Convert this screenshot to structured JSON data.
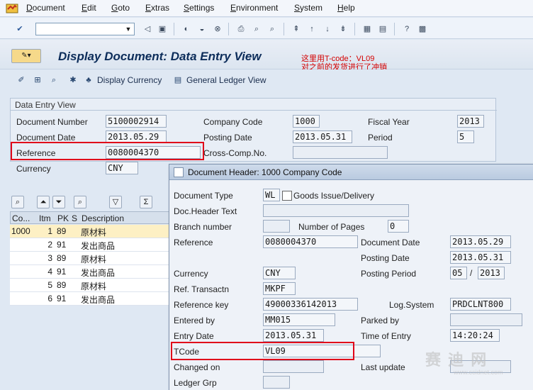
{
  "menu": [
    "Document",
    "Edit",
    "Goto",
    "Extras",
    "Settings",
    "Environment",
    "System",
    "Help"
  ],
  "page_title": "Display Document: Data Entry View",
  "annotation": {
    "line1": "这里用T-code：VL09",
    "line2": "对之前的发货进行了冲销"
  },
  "app_toolbar": {
    "display_currency": "Display Currency",
    "gl_view": "General Ledger View"
  },
  "data_entry": {
    "group_title": "Data Entry View",
    "document_number_label": "Document Number",
    "document_number": "5100002914",
    "document_date_label": "Document Date",
    "document_date": "2013.05.29",
    "reference_label": "Reference",
    "reference": "0080004370",
    "currency_label": "Currency",
    "currency": "CNY",
    "company_code_label": "Company Code",
    "company_code": "1000",
    "posting_date_label": "Posting Date",
    "posting_date": "2013.05.31",
    "cross_comp_label": "Cross-Comp.No.",
    "cross_comp": "",
    "fiscal_year_label": "Fiscal Year",
    "fiscal_year": "2013",
    "period_label": "Period",
    "period": "5"
  },
  "items_table": {
    "headers": [
      "Co...",
      "Itm",
      "PK",
      "S",
      "Description"
    ],
    "rows": [
      {
        "co": "1000",
        "itm": "1",
        "pk": "89",
        "s": "",
        "desc": "原材料"
      },
      {
        "co": "",
        "itm": "2",
        "pk": "91",
        "s": "",
        "desc": "发出商品"
      },
      {
        "co": "",
        "itm": "3",
        "pk": "89",
        "s": "",
        "desc": "原材料"
      },
      {
        "co": "",
        "itm": "4",
        "pk": "91",
        "s": "",
        "desc": "发出商品"
      },
      {
        "co": "",
        "itm": "5",
        "pk": "89",
        "s": "",
        "desc": "原材料"
      },
      {
        "co": "",
        "itm": "6",
        "pk": "91",
        "s": "",
        "desc": "发出商品"
      }
    ]
  },
  "popup": {
    "title": "Document Header: 1000 Company Code",
    "document_type_label": "Document Type",
    "document_type": "WL",
    "document_type_desc": "Goods Issue/Delivery",
    "doc_header_text_label": "Doc.Header Text",
    "doc_header_text": "",
    "branch_number_label": "Branch number",
    "branch_number": "",
    "number_of_pages_label": "Number of Pages",
    "number_of_pages": "0",
    "reference_label": "Reference",
    "reference": "0080004370",
    "document_date_label": "Document Date",
    "document_date": "2013.05.29",
    "posting_date_label": "Posting Date",
    "posting_date": "2013.05.31",
    "currency_label": "Currency",
    "currency": "CNY",
    "posting_period_label": "Posting Period",
    "posting_period": "05",
    "posting_period_year": "2013",
    "posting_period_sep": "/",
    "ref_transactn_label": "Ref. Transactn",
    "ref_transactn": "MKPF",
    "reference_key_label": "Reference key",
    "reference_key": "49000336142013",
    "log_system_label": "Log.System",
    "log_system": "PRDCLNT800",
    "entered_by_label": "Entered by",
    "entered_by": "MM015",
    "parked_by_label": "Parked by",
    "parked_by": "",
    "entry_date_label": "Entry Date",
    "entry_date": "2013.05.31",
    "time_of_entry_label": "Time of Entry",
    "time_of_entry": "14:20:24",
    "tcode_label": "TCode",
    "tcode": "VL09",
    "changed_on_label": "Changed on",
    "changed_on": "",
    "last_update_label": "Last update",
    "last_update": "",
    "ledger_grp_label": "Ledger Grp",
    "ledger_grp": ""
  },
  "watermark": {
    "main": "赛 迪 网",
    "sub": "www.ccidnet.com"
  },
  "colors": {
    "highlight": "#e0001a",
    "selected_row": "#fdf0c4",
    "title": "#0c2c5a"
  }
}
